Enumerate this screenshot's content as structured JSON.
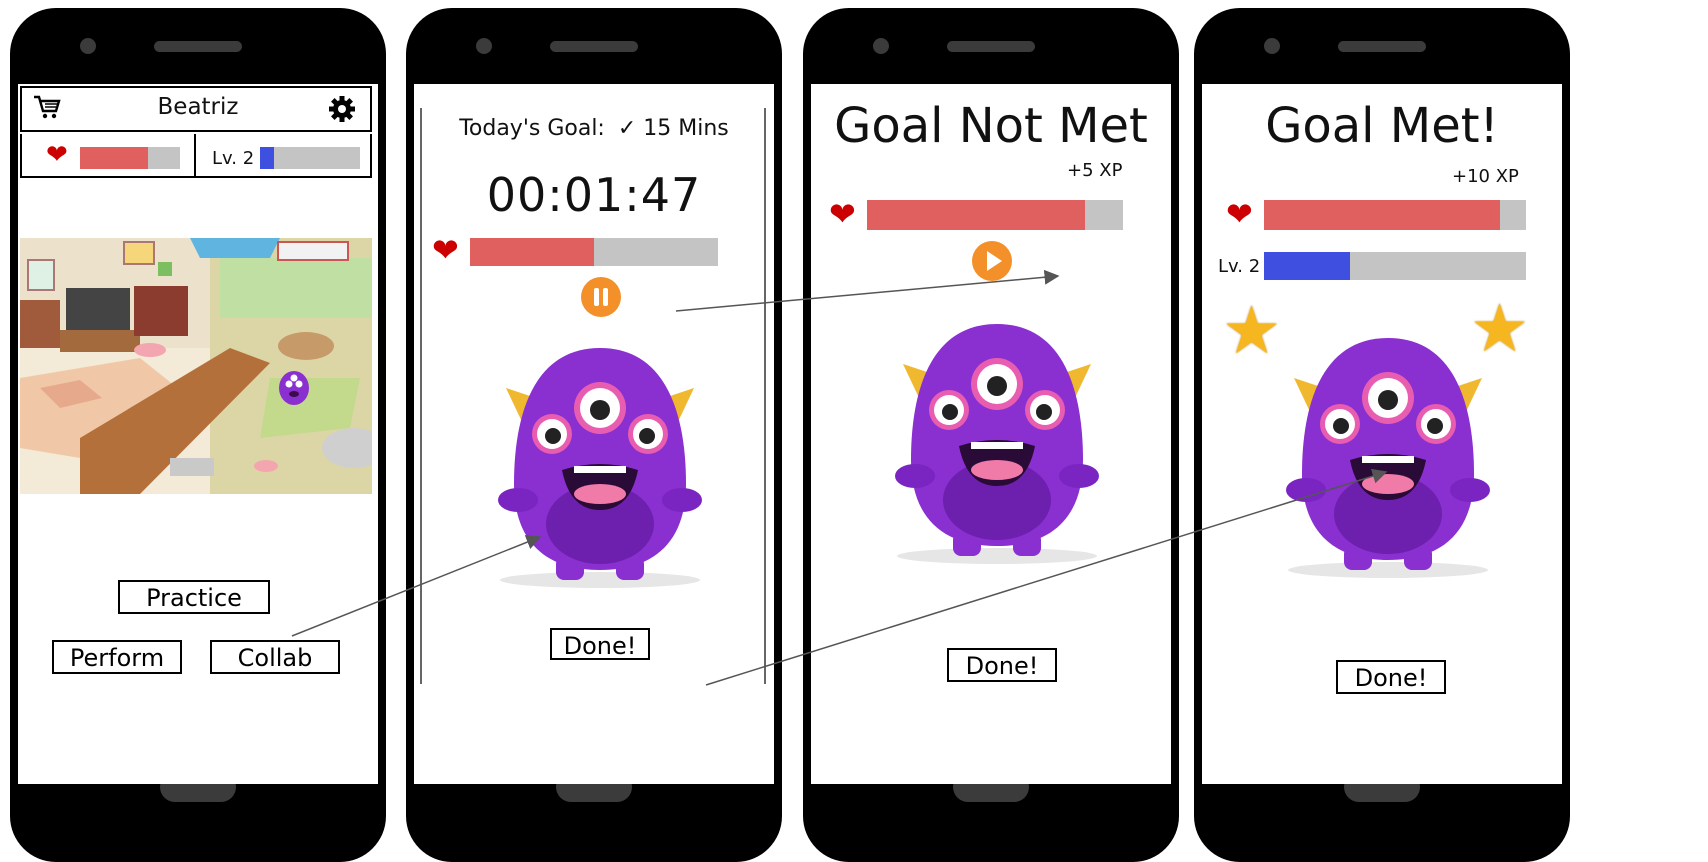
{
  "colors": {
    "health": "#e06060",
    "xp": "#3f50e0",
    "track": "#c4c4c4",
    "heart": "#cc0000",
    "control": "#f3902a",
    "monster": "#8a2fd0",
    "star": "#f6b620"
  },
  "home_screen": {
    "cart_icon": "shopping-cart-icon",
    "user_name": "Beatriz",
    "settings_icon": "gear-icon",
    "health_fraction": 0.68,
    "level_label": "Lv. 2",
    "xp_fraction": 0.14,
    "practice_label": "Practice",
    "perform_label": "Perform",
    "collab_label": "Collab"
  },
  "practice_screen": {
    "goal_label": "Today's Goal:",
    "goal_value": "✓ 15 Mins",
    "timer": "00:01:47",
    "health_fraction": 0.5,
    "pause_icon": "pause-icon",
    "done_label": "Done!"
  },
  "goal_not_met_screen": {
    "title": "Goal Not Met",
    "xp_reward": "+5 XP",
    "health_fraction": 0.85,
    "play_icon": "play-icon",
    "done_label": "Done!"
  },
  "goal_met_screen": {
    "title": "Goal Met!",
    "xp_reward": "+10 XP",
    "health_fraction": 0.9,
    "level_label": "Lv. 2",
    "xp_fraction": 0.33,
    "star_icon": "star-icon",
    "done_label": "Done!"
  }
}
